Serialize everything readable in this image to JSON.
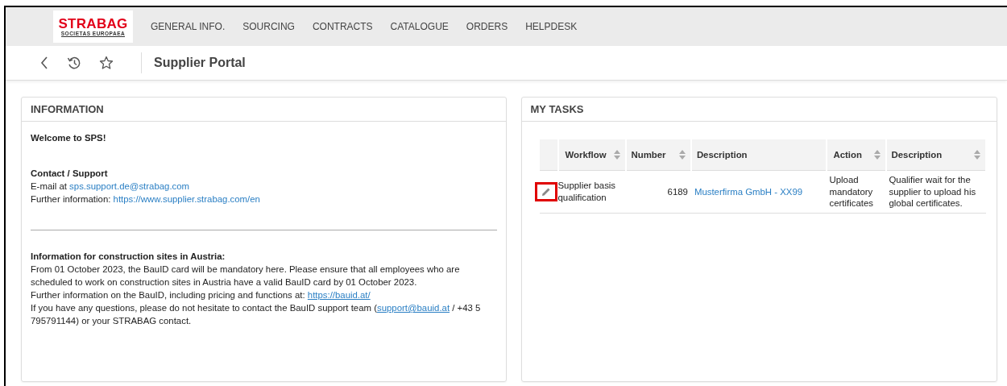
{
  "logo": {
    "name": "STRABAG",
    "tagline": "SOCIETAS EUROPAEA"
  },
  "nav": [
    {
      "label": "GENERAL INFO."
    },
    {
      "label": "SOURCING"
    },
    {
      "label": "CONTRACTS"
    },
    {
      "label": "CATALOGUE"
    },
    {
      "label": "ORDERS"
    },
    {
      "label": "HELPDESK"
    }
  ],
  "page_title": "Supplier Portal",
  "information": {
    "title": "INFORMATION",
    "welcome": "Welcome to SPS!",
    "contact_heading": "Contact / Support",
    "contact_lines": [
      [
        {
          "kind": "text",
          "text": "E-mail at "
        },
        {
          "kind": "link",
          "text": "sps.support.de@strabag.com"
        }
      ],
      [
        {
          "kind": "text",
          "text": "Further information: "
        },
        {
          "kind": "link",
          "text": "https://www.supplier.strabag.com/en"
        }
      ]
    ],
    "austria_heading": "Information for construction sites in Austria:",
    "austria_lines": [
      [
        {
          "kind": "text",
          "text": "From 01 October 2023, the BauID card will be mandatory here. Please ensure that all employees who are scheduled to work on construction sites in Austria have a valid BauID card by 01 October 2023."
        }
      ],
      [
        {
          "kind": "text",
          "text": "Further information on the BauID, including pricing and functions at: "
        },
        {
          "kind": "ulink",
          "text": "https://bauid.at/"
        }
      ],
      [
        {
          "kind": "text",
          "text": "If you have any questions, please do not hesitate to contact the BauID support team ("
        },
        {
          "kind": "ulink",
          "text": "support@bauid.at"
        },
        {
          "kind": "text",
          "text": " / +43 5 795791144) or your STRABAG contact."
        }
      ]
    ]
  },
  "tasks": {
    "title": "MY TASKS",
    "columns": [
      {
        "label": "Workflow",
        "sortable": true
      },
      {
        "label": "Number",
        "sortable": true
      },
      {
        "label": "Description",
        "sortable": false
      },
      {
        "label": "Action",
        "sortable": true
      },
      {
        "label": "Description",
        "sortable": true
      }
    ],
    "rows": [
      {
        "edit_highlighted": true,
        "workflow": "Supplier basis qualification",
        "number": "6189",
        "description": "Musterfirma GmbH - XX99",
        "action": "Upload mandatory certificates",
        "details": "Qualifier wait for the supplier to upload his global certificates."
      }
    ]
  }
}
